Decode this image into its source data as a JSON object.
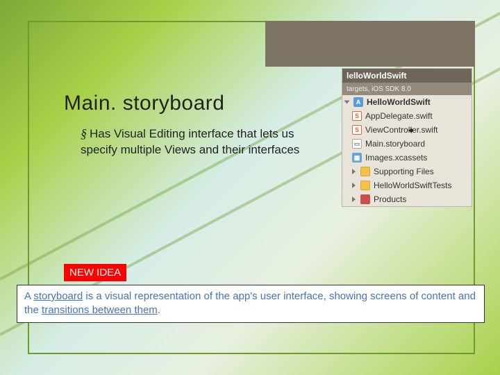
{
  "title": "Main. storyboard",
  "bullet_glyph": "§",
  "body_text": "Has Visual Editing interface that lets us specify multiple Views and their interfaces",
  "newidea_label": "NEW IDEA",
  "callout": {
    "pre": " A ",
    "term": "storyboard",
    "mid": " is a visual representation of the app's user interface, showing screens of content and the ",
    "term2": "transitions between them",
    "post": "."
  },
  "panel": {
    "header": "lelloWorldSwift",
    "subheader": "targets, iOS SDK 8.0",
    "root": "HelloWorldSwift",
    "items": [
      {
        "icon": "swift",
        "label": "AppDelegate.swift"
      },
      {
        "icon": "swift",
        "label": "ViewController.swift"
      },
      {
        "icon": "sb",
        "label": "Main.storyboard"
      },
      {
        "icon": "assets",
        "label": "Images.xcassets"
      },
      {
        "icon": "folder",
        "label": "Supporting Files"
      },
      {
        "icon": "folder",
        "label": "HelloWorldSwiftTests"
      },
      {
        "icon": "prod",
        "label": "Products"
      }
    ]
  }
}
